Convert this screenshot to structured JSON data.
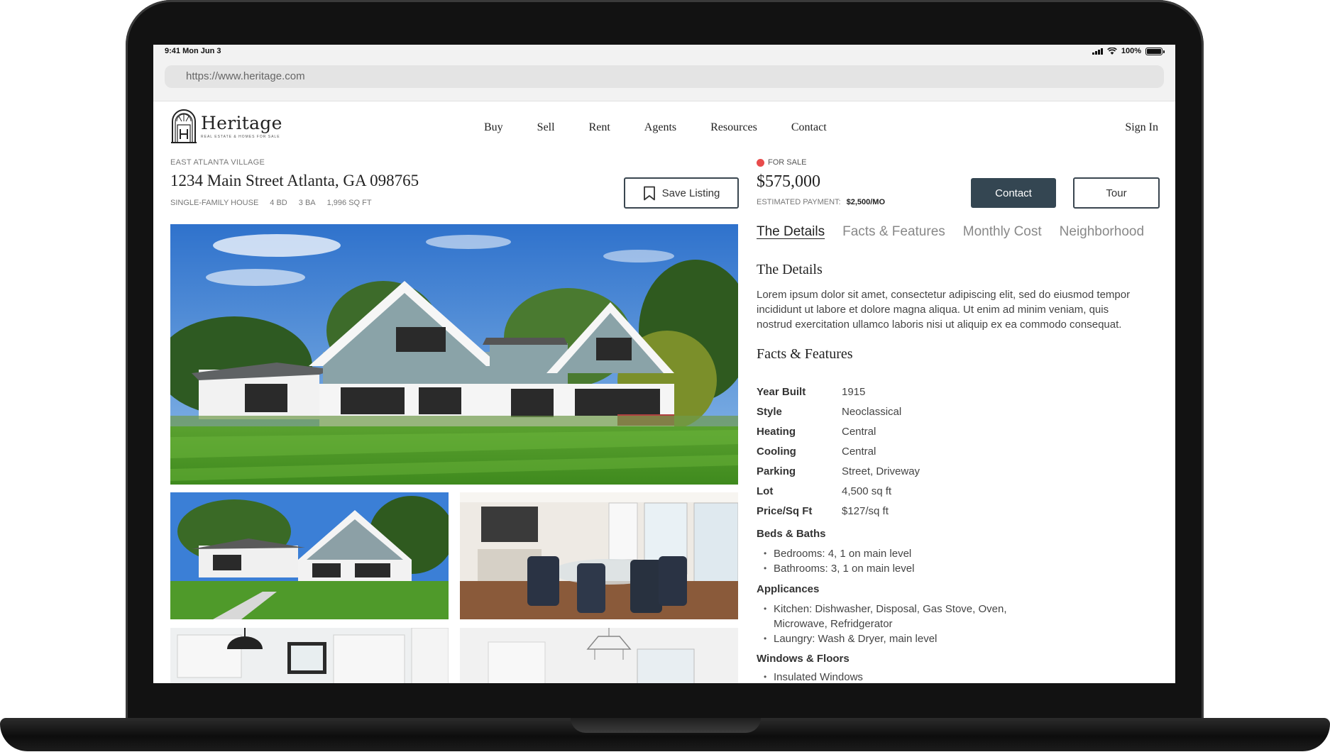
{
  "status_bar": {
    "time": "9:41  Mon Jun 3",
    "battery": "100%"
  },
  "browser": {
    "url": "https://www.heritage.com"
  },
  "brand": {
    "name": "Heritage",
    "tagline": "REAL ESTATE & HOMES FOR SALE"
  },
  "nav": {
    "items": [
      "Buy",
      "Sell",
      "Rent",
      "Agents",
      "Resources",
      "Contact"
    ],
    "sign_in": "Sign In"
  },
  "listing": {
    "neighborhood": "EAST ATLANTA VILLAGE",
    "address": "1234 Main Street Atlanta, GA 098765",
    "specs": [
      "SINGLE-FAMILY HOUSE",
      "4 BD",
      "3 BA",
      "1,996 SQ FT"
    ],
    "save_label": "Save Listing",
    "status": "FOR SALE",
    "price": "$575,000",
    "est_label": "ESTIMATED PAYMENT:",
    "est_value": "$2,500/MO",
    "contact_label": "Contact",
    "tour_label": "Tour"
  },
  "tabs": [
    "The Details",
    "Facts & Features",
    "Monthly Cost",
    "Neighborhood"
  ],
  "details": {
    "title": "The Details",
    "body": "Lorem ipsum dolor sit amet, consectetur adipiscing elit, sed do eiusmod tempor incididunt ut labore et dolore magna aliqua. Ut enim ad minim veniam, quis nostrud exercitation ullamco laboris nisi ut aliquip ex ea commodo consequat."
  },
  "facts": {
    "title": "Facts & Features",
    "rows": [
      {
        "label": "Year Built",
        "value": "1915"
      },
      {
        "label": "Style",
        "value": "Neoclassical"
      },
      {
        "label": "Heating",
        "value": "Central"
      },
      {
        "label": "Cooling",
        "value": "Central"
      },
      {
        "label": "Parking",
        "value": "Street, Driveway"
      },
      {
        "label": "Lot",
        "value": "4,500 sq ft"
      },
      {
        "label": "Price/Sq Ft",
        "value": "$127/sq ft"
      }
    ],
    "beds_title": "Beds & Baths",
    "beds": [
      "Bedrooms: 4, 1 on main level",
      "Bathrooms: 3, 1 on main level"
    ],
    "appliances_title": "Applicances",
    "appliances": [
      "Kitchen: Dishwasher, Disposal, Gas Stove, Oven, Microwave, Refridgerator",
      "Laungry: Wash & Dryer, main level"
    ],
    "windows_title": "Windows & Floors",
    "windows": [
      "Insulated Windows"
    ]
  },
  "theme": {
    "primary": "#344652",
    "status_dot": "#e84c4c",
    "sky": "#3f86d8",
    "lawn": "#4f9a2a"
  },
  "icons": {
    "save": "bookmark-icon",
    "logo": "arched-door-icon"
  }
}
